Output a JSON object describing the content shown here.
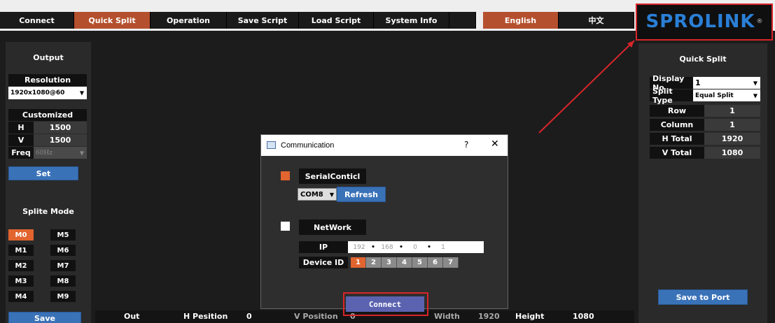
{
  "menu": {
    "connect": "Connect",
    "quick_split": "Quick Split",
    "operation": "Operation",
    "save_script": "Save Script",
    "load_script": "Load Script",
    "system_info": "System Info",
    "english": "English",
    "chinese": "中文"
  },
  "logo": {
    "text": "SPROLINK",
    "reg": "®"
  },
  "output": {
    "title": "Output",
    "resolution_label": "Resolution",
    "resolution_value": "1920x1080@60",
    "customized_label": "Customized",
    "h_label": "H",
    "h_value": "1500",
    "v_label": "V",
    "v_value": "1500",
    "freq_label": "Freq",
    "freq_value": "60Hz",
    "set_label": "Set"
  },
  "split_mode": {
    "title": "Splite Mode",
    "modes": [
      "M0",
      "M5",
      "M1",
      "M6",
      "M2",
      "M7",
      "M3",
      "M8",
      "M4",
      "M9"
    ],
    "save_label": "Save"
  },
  "quick_split": {
    "title": "Quick Split",
    "display_no_label": "Display No",
    "display_no_value": "1",
    "split_type_label": "Split Type",
    "split_type_value": "Equal Split",
    "row_label": "Row",
    "row_value": "1",
    "column_label": "Column",
    "column_value": "1",
    "h_total_label": "H Total",
    "h_total_value": "1920",
    "v_total_label": "V Total",
    "v_total_value": "1080",
    "save_to_port": "Save to Port"
  },
  "bottom": {
    "out": "Out",
    "h_position": "H Pesition",
    "h_position_value": "0",
    "v_position": "V Position",
    "v_position_value": "0",
    "width": "Width",
    "width_value": "1920",
    "height": "Height",
    "height_value": "1080"
  },
  "dialog": {
    "title": "Communication",
    "help": "?",
    "close": "✕",
    "serial_label": "SerialConticl",
    "com_value": "COM8",
    "refresh_label": "Refresh",
    "network_label": "NetWork",
    "ip_label": "IP",
    "ip_parts": [
      "192",
      "168",
      "0",
      "1"
    ],
    "device_id_label": "Device ID",
    "device_ids": [
      "1",
      "2",
      "3",
      "4",
      "5",
      "6",
      "7"
    ],
    "connect_label": "Connect"
  },
  "colors": {
    "accent_orange": "#e2642f",
    "menu_active": "#b5502e",
    "button_blue": "#3a72b8",
    "highlight_red": "#d9252a",
    "connect_purple": "#5b63b0"
  }
}
